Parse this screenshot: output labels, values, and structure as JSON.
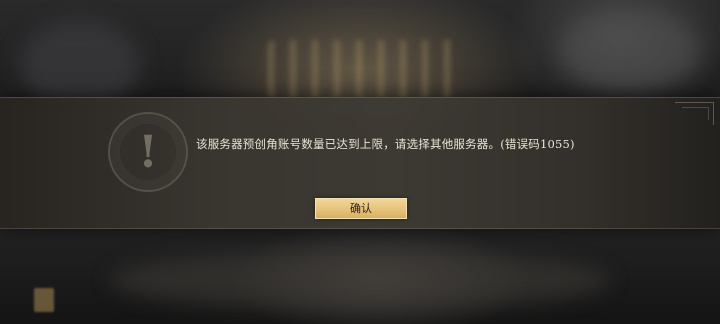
{
  "dialog": {
    "message": "该服务器预创角账号数量已达到上限，请选择其他服务器。(错误码1055)",
    "confirm_label": "确认",
    "icon": "exclamation-icon",
    "icon_glyph": "!"
  },
  "colors": {
    "accent_button": "#e6c27a",
    "message_text": "#e9e4d6"
  }
}
